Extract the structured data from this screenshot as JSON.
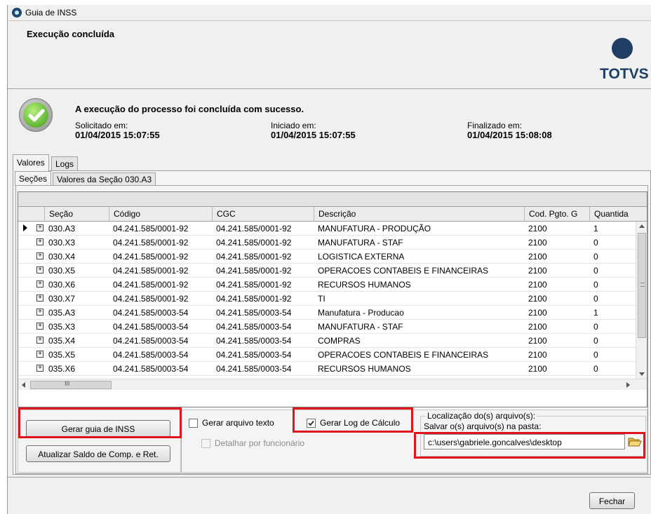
{
  "window": {
    "title": "Guia de INSS"
  },
  "header": {
    "title": "Execução concluída",
    "logo_text": "TOTVS"
  },
  "status": {
    "message": "A execução do processo foi concluída com sucesso.",
    "requested_label": "Solicitado em:",
    "requested_value": "01/04/2015 15:07:55",
    "started_label": "Iniciado em:",
    "started_value": "01/04/2015 15:07:55",
    "finished_label": "Finalizado em:",
    "finished_value": "01/04/2015 15:08:08"
  },
  "tabs": [
    "Valores",
    "Logs"
  ],
  "inner_tabs": [
    "Seções",
    "Valores da Seção 030.A3"
  ],
  "grid": {
    "columns": [
      "Seção",
      "Código",
      "CGC",
      "Descrição",
      "Cod. Pgto. G",
      "Quantida"
    ],
    "rows": [
      [
        "030.A3",
        "04.241.585/0001-92",
        "04.241.585/0001-92",
        "MANUFATURA - PRODUÇÃO",
        "2100",
        "1"
      ],
      [
        "030.X3",
        "04.241.585/0001-92",
        "04.241.585/0001-92",
        "MANUFATURA - STAF",
        "2100",
        "0"
      ],
      [
        "030.X4",
        "04.241.585/0001-92",
        "04.241.585/0001-92",
        "LOGISTICA EXTERNA",
        "2100",
        "0"
      ],
      [
        "030.X5",
        "04.241.585/0001-92",
        "04.241.585/0001-92",
        "OPERACOES CONTABEIS E FINANCEIRAS",
        "2100",
        "0"
      ],
      [
        "030.X6",
        "04.241.585/0001-92",
        "04.241.585/0001-92",
        "RECURSOS HUMANOS",
        "2100",
        "0"
      ],
      [
        "030.X7",
        "04.241.585/0001-92",
        "04.241.585/0001-92",
        "TI",
        "2100",
        "0"
      ],
      [
        "035.A3",
        "04.241.585/0003-54",
        "04.241.585/0003-54",
        "Manufatura - Producao",
        "2100",
        "1"
      ],
      [
        "035.X3",
        "04.241.585/0003-54",
        "04.241.585/0003-54",
        "MANUFATURA - STAF",
        "2100",
        "0"
      ],
      [
        "035.X4",
        "04.241.585/0003-54",
        "04.241.585/0003-54",
        "COMPRAS",
        "2100",
        "0"
      ],
      [
        "035.X5",
        "04.241.585/0003-54",
        "04.241.585/0003-54",
        "OPERACOES CONTABEIS E FINANCEIRAS",
        "2100",
        "0"
      ],
      [
        "035.X6",
        "04.241.585/0003-54",
        "04.241.585/0003-54",
        "RECURSOS HUMANOS",
        "2100",
        "0"
      ],
      [
        "035.X7",
        "04.241.585/0003-54",
        "04.241.585/0003-54",
        "TI",
        "2100",
        "0"
      ]
    ],
    "hscroll_grip": "III"
  },
  "actions": {
    "generate_button": "Gerar guia de INSS",
    "update_button": "Atualizar Saldo de Comp. e Ret.",
    "text_file_label": "Gerar arquivo texto",
    "calc_log_label": "Gerar Log de Cálculo",
    "detail_label": "Detalhar por funcionário",
    "location_group_label": "Localização do(s) arquivo(s):",
    "save_folder_label": "Salvar o(s) arquivo(s) na pasta:",
    "path_value": "c:\\users\\gabriele.goncalves\\desktop",
    "close_button": "Fechar"
  },
  "colors": {
    "highlight_red": "#e0151c",
    "totvs_blue": "#1f3e63"
  },
  "icons": [
    "app-icon",
    "success-check-icon",
    "expand-plus-icon",
    "row-selector-arrow-icon",
    "checkmark-icon",
    "folder-open-icon"
  ]
}
